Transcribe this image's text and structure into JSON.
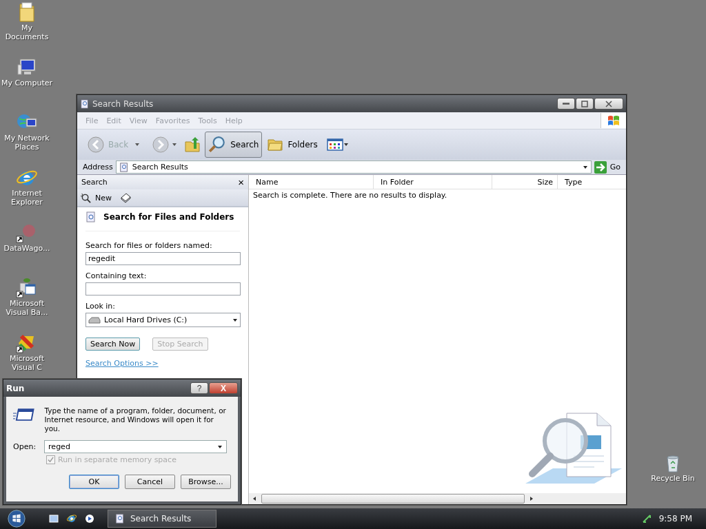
{
  "desktop": {
    "icons": [
      {
        "label": "My Documents",
        "kind": "folder",
        "shortcut": false
      },
      {
        "label": "My Computer",
        "kind": "computer",
        "shortcut": false
      },
      {
        "label": "My Network Places",
        "kind": "network",
        "shortcut": false
      },
      {
        "label": "Internet Explorer",
        "kind": "browser",
        "shortcut": false
      },
      {
        "label": "DataWago...",
        "kind": "blur",
        "shortcut": true
      },
      {
        "label": "Microsoft Visual Ba...",
        "kind": "vb",
        "shortcut": true
      },
      {
        "label": "Microsoft Visual C",
        "kind": "vc",
        "shortcut": true
      }
    ],
    "recycle_bin": {
      "label": "Recycle Bin"
    }
  },
  "explorer": {
    "title": "Search Results",
    "menu": [
      "File",
      "Edit",
      "View",
      "Favorites",
      "Tools",
      "Help"
    ],
    "toolbar": {
      "back": {
        "label": "Back",
        "disabled": true
      },
      "forward": {
        "disabled": true
      },
      "search": {
        "label": "Search",
        "selected": true
      },
      "folders": {
        "label": "Folders",
        "selected": false
      }
    },
    "address": {
      "label": "Address",
      "value": "Search Results",
      "go": "Go"
    },
    "search_pane": {
      "title": "Search",
      "close": "×",
      "new": "New",
      "heading": "Search for Files and Folders",
      "named": {
        "label": "Search for files or folders named:",
        "value": "regedit"
      },
      "containing": {
        "label": "Containing text:"
      },
      "look_in": {
        "label": "Look in:",
        "value": "Local Hard Drives (C:)"
      },
      "buttons": [
        {
          "label": "Search Now",
          "disabled": false
        },
        {
          "label": "Stop Search",
          "disabled": true
        }
      ],
      "options_link": "Search Options  >>"
    },
    "results": {
      "columns": [
        "Name",
        "In Folder",
        "Size",
        "Type"
      ],
      "message": "Search is complete. There are no results to display."
    }
  },
  "run_dialog": {
    "title": "Run",
    "help": "?",
    "close": "X",
    "instructions": "Type the name of a program, folder, document, or Internet resource, and Windows will open it for you.",
    "open_label": "Open:",
    "open_value": "reged",
    "checkbox": {
      "label": "Run in separate memory space",
      "checked": true,
      "disabled": true
    },
    "buttons": [
      {
        "label": "OK",
        "default": true
      },
      {
        "label": "Cancel",
        "default": false
      },
      {
        "label": "Browse...",
        "default": false
      }
    ]
  },
  "taskbar": {
    "tasks": [
      {
        "label": "Search Results",
        "selected": false
      }
    ],
    "clock": "9:58 PM"
  }
}
